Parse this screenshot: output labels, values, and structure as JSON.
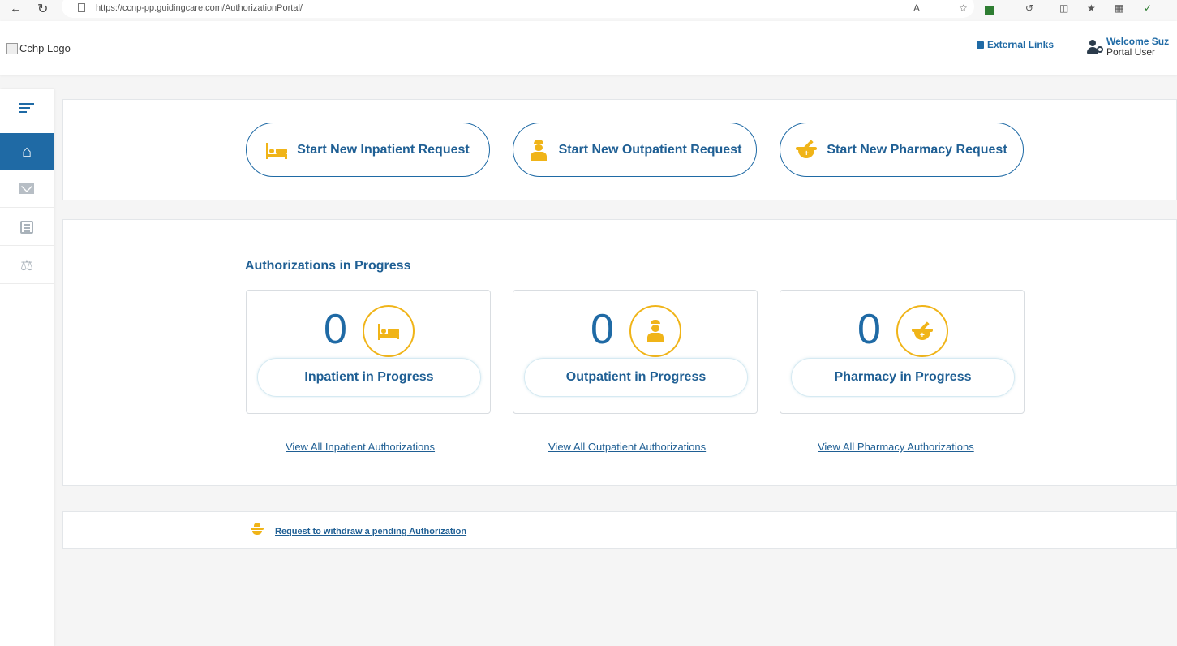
{
  "browser": {
    "url": "https://ccnp-pp.guidingcare.com/AuthorizationPortal/",
    "back_icon": "arrow-left-icon",
    "reload_icon": "reload-icon"
  },
  "header": {
    "logo_alt": "Cchp Logo",
    "external_links_label": "External Links",
    "welcome_text": "Welcome Suz",
    "user_role": "Portal User"
  },
  "sidebar": {
    "items": [
      {
        "name": "menu",
        "icon": "hamburger-menu-icon"
      },
      {
        "name": "home",
        "icon": "home-icon",
        "active": true
      },
      {
        "name": "messages",
        "icon": "envelope-icon"
      },
      {
        "name": "list",
        "icon": "list-icon"
      },
      {
        "name": "appeals",
        "icon": "scale-icon"
      }
    ]
  },
  "start_requests": {
    "inpatient": "Start New Inpatient Request",
    "outpatient": "Start New Outpatient Request",
    "pharmacy": "Start New Pharmacy Request"
  },
  "auth_progress": {
    "title": "Authorizations in Progress",
    "cards": {
      "inpatient": {
        "count": "0",
        "label": "Inpatient in Progress",
        "link": "View All Inpatient Authorizations"
      },
      "outpatient": {
        "count": "0",
        "label": "Outpatient in Progress",
        "link": "View All Outpatient Authorizations"
      },
      "pharmacy": {
        "count": "0",
        "label": "Pharmacy in Progress",
        "link": "View All Pharmacy Authorizations"
      }
    }
  },
  "withdraw": {
    "link": "Request to withdraw a pending Authorization"
  },
  "colors": {
    "primary": "#1f6aa5",
    "accent": "#f0b418",
    "background": "#f5f5f5"
  }
}
